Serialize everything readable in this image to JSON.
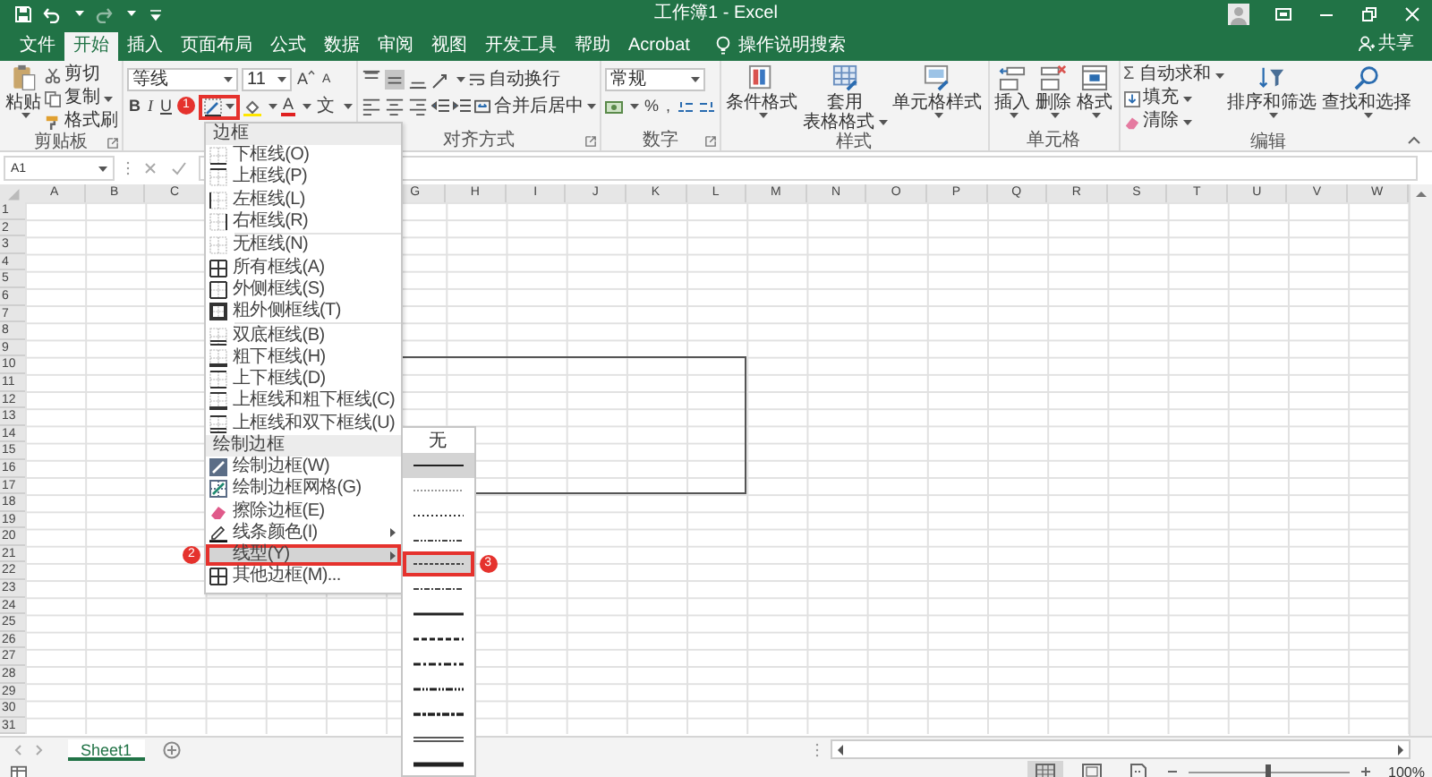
{
  "title_bar": {
    "title": "工作簿1 - Excel"
  },
  "tabs": [
    {
      "label": "文件",
      "selected": false
    },
    {
      "label": "开始",
      "selected": true
    },
    {
      "label": "插入",
      "selected": false
    },
    {
      "label": "页面布局",
      "selected": false
    },
    {
      "label": "公式",
      "selected": false
    },
    {
      "label": "数据",
      "selected": false
    },
    {
      "label": "审阅",
      "selected": false
    },
    {
      "label": "视图",
      "selected": false
    },
    {
      "label": "开发工具",
      "selected": false
    },
    {
      "label": "帮助",
      "selected": false
    },
    {
      "label": "Acrobat",
      "selected": false
    }
  ],
  "tell_me": "操作说明搜索",
  "share": "共享",
  "clipboard": {
    "paste": "粘贴",
    "cut": "剪切",
    "copy": "复制",
    "format_painter": "格式刷",
    "label": "剪贴板"
  },
  "font": {
    "name": "等线",
    "size": "11",
    "grow": "A",
    "shrink": "A",
    "bold": "B",
    "italic": "I",
    "underline": "U",
    "font_color": "A",
    "phonetic": "文",
    "border_callout": "1"
  },
  "alignment": {
    "vertical": [
      {
        "kind": "top",
        "selected": false
      },
      {
        "kind": "middle",
        "selected": true
      },
      {
        "kind": "bottom",
        "selected": false
      }
    ],
    "horizontal": [
      {
        "kind": "left",
        "selected": false
      },
      {
        "kind": "center",
        "selected": false
      },
      {
        "kind": "right",
        "selected": false
      }
    ],
    "wrap_text": "自动换行",
    "merge": "合并后居中",
    "label": "对齐方式"
  },
  "number": {
    "format": "常规",
    "percent": "%",
    "comma": ",",
    "label": "数字"
  },
  "styles": {
    "buttons": [
      {
        "kind": "conditional",
        "label": [
          "条件格式"
        ]
      },
      {
        "kind": "table",
        "label": [
          "套用",
          "表格格式"
        ]
      },
      {
        "kind": "cell",
        "label": [
          "单元格样式"
        ]
      }
    ],
    "label": "样式"
  },
  "cells": {
    "buttons": [
      {
        "kind": "insert",
        "label": "插入"
      },
      {
        "kind": "delete",
        "label": "删除"
      },
      {
        "kind": "format",
        "label": "格式"
      }
    ],
    "label": "单元格"
  },
  "editing": {
    "autosum_symbol": "Σ",
    "autosum": "自动求和",
    "fill": "填充",
    "clear": "清除",
    "sort": "排序和筛选",
    "find": "查找和选择",
    "label": "编辑"
  },
  "formula_bar": {
    "name_box": "A1"
  },
  "columns": [
    "A",
    "B",
    "C",
    "G",
    "H",
    "I",
    "J",
    "K",
    "L",
    "M",
    "N",
    "O",
    "P",
    "Q",
    "R",
    "S",
    "T",
    "U",
    "V",
    "W"
  ],
  "rows": [
    "1",
    "2",
    "3",
    "4",
    "5",
    "6",
    "7",
    "8",
    "9",
    "10",
    "11",
    "12",
    "13",
    "14",
    "15",
    "16",
    "17",
    "18",
    "19",
    "20",
    "21",
    "22",
    "23",
    "24",
    "25",
    "26",
    "27",
    "28",
    "29",
    "30",
    "31"
  ],
  "border_menu": {
    "sections": [
      {
        "heading": "边框",
        "groups": [
          [
            {
              "label": "下框线(O)",
              "kind": "bottom",
              "highlighted": false
            },
            {
              "label": "上框线(P)",
              "kind": "top",
              "highlighted": false
            },
            {
              "label": "左框线(L)",
              "kind": "left",
              "highlighted": false
            },
            {
              "label": "右框线(R)",
              "kind": "right",
              "highlighted": false
            }
          ],
          [
            {
              "label": "无框线(N)",
              "kind": "none",
              "highlighted": false
            },
            {
              "label": "所有框线(A)",
              "kind": "all",
              "highlighted": false
            },
            {
              "label": "外侧框线(S)",
              "kind": "outside",
              "highlighted": false
            },
            {
              "label": "粗外侧框线(T)",
              "kind": "thick_outside",
              "highlighted": false
            }
          ],
          [
            {
              "label": "双底框线(B)",
              "kind": "double_bottom",
              "highlighted": false
            },
            {
              "label": "粗下框线(H)",
              "kind": "thick_bottom",
              "highlighted": false
            },
            {
              "label": "上下框线(D)",
              "kind": "top_bottom",
              "highlighted": false
            },
            {
              "label": "上框线和粗下框线(C)",
              "kind": "top_thick_bottom",
              "highlighted": false
            },
            {
              "label": "上框线和双下框线(U)",
              "kind": "top_double_bottom",
              "highlighted": false
            }
          ]
        ]
      },
      {
        "heading": "绘制边框",
        "groups": [
          [
            {
              "label": "绘制边框(W)",
              "kind": "draw",
              "highlighted": false
            },
            {
              "label": "绘制边框网格(G)",
              "kind": "draw_grid",
              "highlighted": false
            },
            {
              "label": "擦除边框(E)",
              "kind": "erase",
              "highlighted": false
            },
            {
              "label": "线条颜色(I)",
              "kind": "line_color",
              "has_submenu": true,
              "highlighted": false
            },
            {
              "label": "线型(Y)",
              "kind": "plain",
              "has_submenu": true,
              "highlighted": true,
              "callout": "2"
            },
            {
              "label": "其他边框(M)...",
              "kind": "more",
              "highlighted": false
            }
          ]
        ]
      }
    ]
  },
  "line_styles": [
    {
      "kind": "none",
      "label": "无",
      "highlighted": false
    },
    {
      "kind": "thin",
      "highlighted": true
    },
    {
      "kind": "hair",
      "highlighted": false
    },
    {
      "kind": "dotted",
      "highlighted": false
    },
    {
      "kind": "dash_dot_dot",
      "highlighted": false
    },
    {
      "kind": "dashed",
      "highlighted": true,
      "callout": "3"
    },
    {
      "kind": "dash_dot",
      "highlighted": false
    },
    {
      "kind": "medium",
      "highlighted": false
    },
    {
      "kind": "medium_dashed",
      "highlighted": false
    },
    {
      "kind": "medium_dash_dot",
      "highlighted": false
    },
    {
      "kind": "medium_dash_dot_dot",
      "highlighted": false
    },
    {
      "kind": "slant_dash_dot",
      "highlighted": false
    },
    {
      "kind": "double",
      "highlighted": false
    },
    {
      "kind": "thick",
      "highlighted": false
    }
  ],
  "sheet_tabs": [
    {
      "label": "Sheet1",
      "selected": true
    }
  ],
  "status_bar": {
    "views": [
      {
        "kind": "normal",
        "selected": true
      },
      {
        "kind": "page_layout",
        "selected": false
      },
      {
        "kind": "page_break",
        "selected": false
      }
    ],
    "zoom": {
      "level": 0.5,
      "reading": "100%"
    }
  }
}
